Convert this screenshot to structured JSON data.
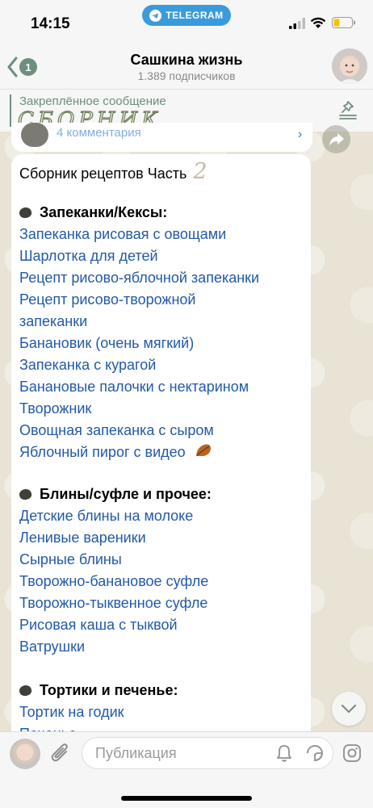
{
  "status": {
    "time": "14:15",
    "back_to_app": "TELEGRAM"
  },
  "header": {
    "unread_count": "1",
    "title": "Сашкина жизнь",
    "subtitle": "1.389 подписчиков"
  },
  "pinned": {
    "label": "Закреплённое сообщение",
    "text": "СБОРНИК"
  },
  "prev_post": {
    "comments": "4 комментария"
  },
  "message": {
    "title": "Сборник рецептов Часть",
    "title_number": "2",
    "sections": [
      {
        "heading": "Запеканки/Кексы:",
        "links": [
          "Запеканка рисовая с овощами",
          "Шарлотка для детей",
          "Рецепт рисово-яблочной запеканки",
          "Рецепт рисово-творожной",
          "запеканки",
          "Банановик (очень мягкий)",
          "Запеканка с курагой",
          "Банановые палочки с нектарином",
          "Творожник",
          "Овощная запеканка с сыром",
          "Яблочный пирог с видео"
        ]
      },
      {
        "heading": "Блины/суфле и прочее:",
        "links": [
          "Детские блины на молоке",
          "Ленивые вареники",
          "Сырные блины",
          "Творожно-банановое суфле",
          "Творожно-тыквенное суфле",
          "Рисовая каша с тыквой",
          "Ватрушки"
        ]
      },
      {
        "heading": "Тортики и печенье:",
        "links": [
          "Тортик на годик",
          "Печенье"
        ]
      }
    ]
  },
  "input": {
    "placeholder": "Публикация"
  },
  "colors": {
    "link": "#2259a8",
    "accent": "#6e8f7d",
    "telegram_blue": "#3a9bdc"
  }
}
